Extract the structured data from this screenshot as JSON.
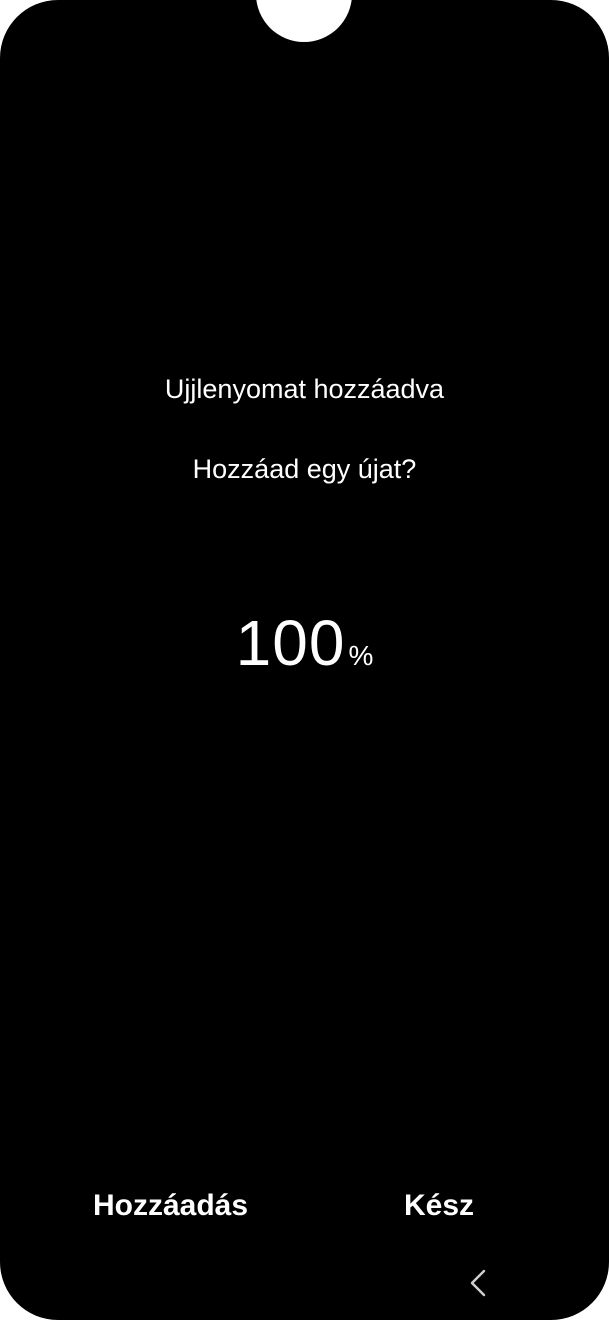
{
  "enrollment": {
    "title": "Ujjlenyomat hozzáadva",
    "subtitle": "Hozzáad egy újat?",
    "progress_value": "100",
    "progress_unit": "%"
  },
  "actions": {
    "add_label": "Hozzáadás",
    "done_label": "Kész"
  },
  "navigation": {
    "back_icon": "chevron-left-icon"
  },
  "colors": {
    "background": "#000000",
    "text": "#ffffff"
  }
}
